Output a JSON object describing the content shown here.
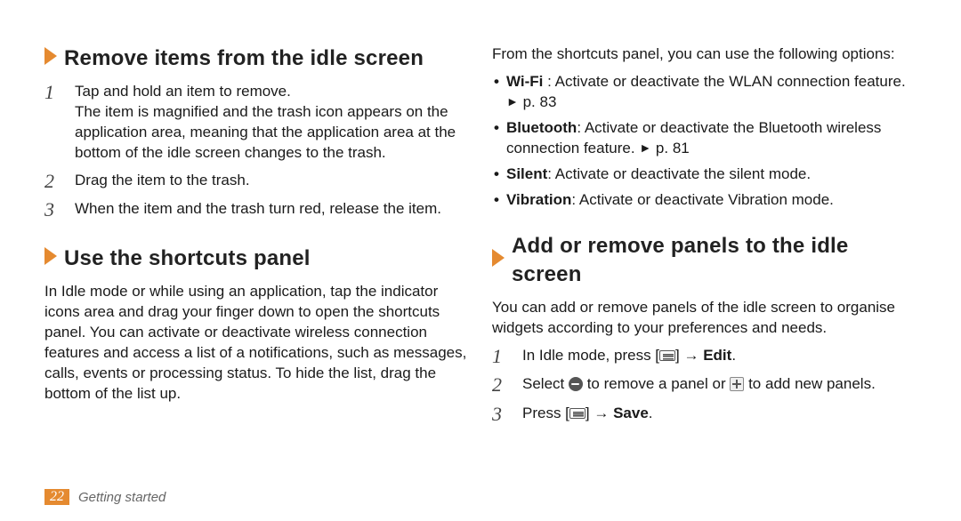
{
  "section1": {
    "title": "Remove items from the idle screen",
    "step1": "Tap and hold an item to remove.",
    "step1b": "The item is magnified and the trash icon appears on the application area, meaning that the application area at the bottom of the idle screen changes to the trash.",
    "step2": "Drag the item to the trash.",
    "step3": "When the item and the trash turn red, release the item."
  },
  "section2": {
    "title": "Use the shortcuts panel",
    "para": "In Idle mode or while using an application, tap the indicator icons area and drag your finger down to open the shortcuts panel. You can activate or deactivate wireless connection features and access a list of a notifications, such as messages, calls, events or processing status. To hide the list, drag the bottom of the list up."
  },
  "rightIntro": "From the shortcuts panel, you can use the following options:",
  "bullets": {
    "wifi_label": "Wi-Fi",
    "wifi_text": " : Activate or deactivate the WLAN connection feature. ",
    "wifi_ref": "p. 83",
    "bt_label": "Bluetooth",
    "bt_text": ": Activate or deactivate the Bluetooth wireless connection feature. ",
    "bt_ref": "p. 81",
    "silent_label": "Silent",
    "silent_text": ": Activate or deactivate the silent mode.",
    "vib_label": "Vibration",
    "vib_text": ": Activate or deactivate Vibration mode."
  },
  "section3": {
    "title": "Add or remove panels to the idle screen",
    "para": "You can add or remove panels of the idle screen to organise widgets according to your preferences and needs.",
    "step1_pre": "In Idle mode, press [",
    "step1_post": "] → ",
    "step1_bold": "Edit",
    "step1_end": ".",
    "step2_pre": "Select ",
    "step2_mid": " to remove a panel or ",
    "step2_post": " to add new panels.",
    "step3_pre": "Press [",
    "step3_post": "] → ",
    "step3_bold": "Save",
    "step3_end": "."
  },
  "footer": {
    "page": "22",
    "chapter": "Getting started"
  },
  "glyphs": {
    "tri": "►"
  }
}
